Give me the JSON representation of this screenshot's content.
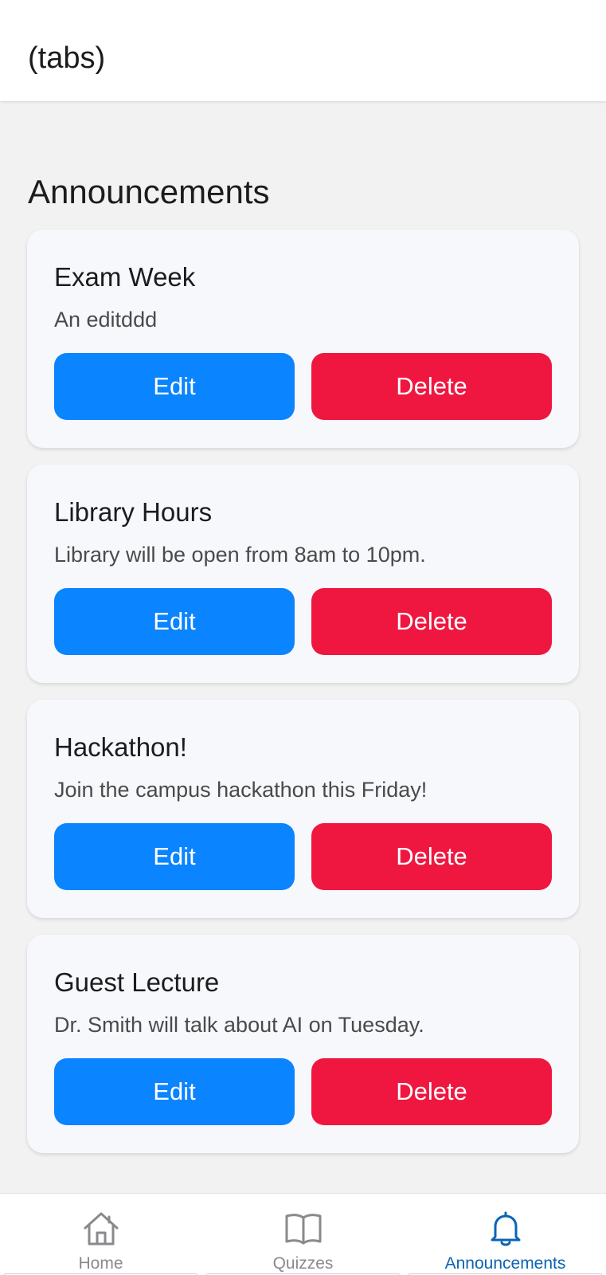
{
  "header": {
    "title": "(tabs)"
  },
  "section": {
    "title": "Announcements"
  },
  "announcements": [
    {
      "title": "Exam Week",
      "body": "An editddd",
      "edit_label": "Edit",
      "delete_label": "Delete"
    },
    {
      "title": "Library Hours",
      "body": "Library will be open from 8am to 10pm.",
      "edit_label": "Edit",
      "delete_label": "Delete"
    },
    {
      "title": "Hackathon!",
      "body": "Join the campus hackathon this Friday!",
      "edit_label": "Edit",
      "delete_label": "Delete"
    },
    {
      "title": "Guest Lecture",
      "body": "Dr. Smith will talk about AI on Tuesday.",
      "edit_label": "Edit",
      "delete_label": "Delete"
    }
  ],
  "tabs": [
    {
      "label": "Home",
      "icon": "home-icon",
      "active": false
    },
    {
      "label": "Quizzes",
      "icon": "book-icon",
      "active": false
    },
    {
      "label": "Announcements",
      "icon": "bell-icon",
      "active": true
    }
  ],
  "colors": {
    "edit_button": "#0a84ff",
    "delete_button": "#ef1740",
    "active_tab": "#0a64b4",
    "inactive_tab": "#8a8a8e"
  }
}
